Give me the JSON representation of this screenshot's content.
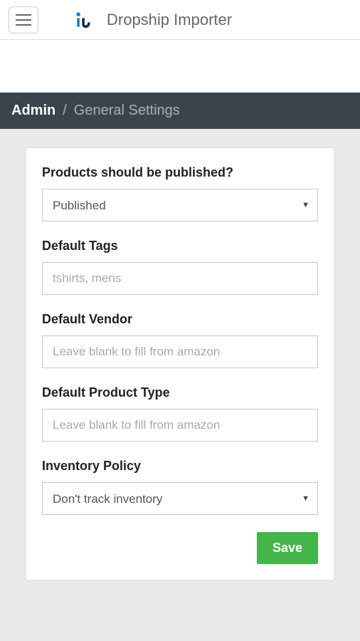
{
  "header": {
    "app_title": "Dropship Importer"
  },
  "breadcrumb": {
    "root": "Admin",
    "separator": "/",
    "current": "General Settings"
  },
  "form": {
    "published": {
      "label": "Products should be published?",
      "value": "Published"
    },
    "tags": {
      "label": "Default Tags",
      "placeholder": "tshirts, mens",
      "value": ""
    },
    "vendor": {
      "label": "Default Vendor",
      "placeholder": "Leave blank to fill from amazon",
      "value": ""
    },
    "product_type": {
      "label": "Default Product Type",
      "placeholder": "Leave blank to fill from amazon",
      "value": ""
    },
    "inventory": {
      "label": "Inventory Policy",
      "value": "Don't track inventory"
    },
    "save_label": "Save"
  }
}
